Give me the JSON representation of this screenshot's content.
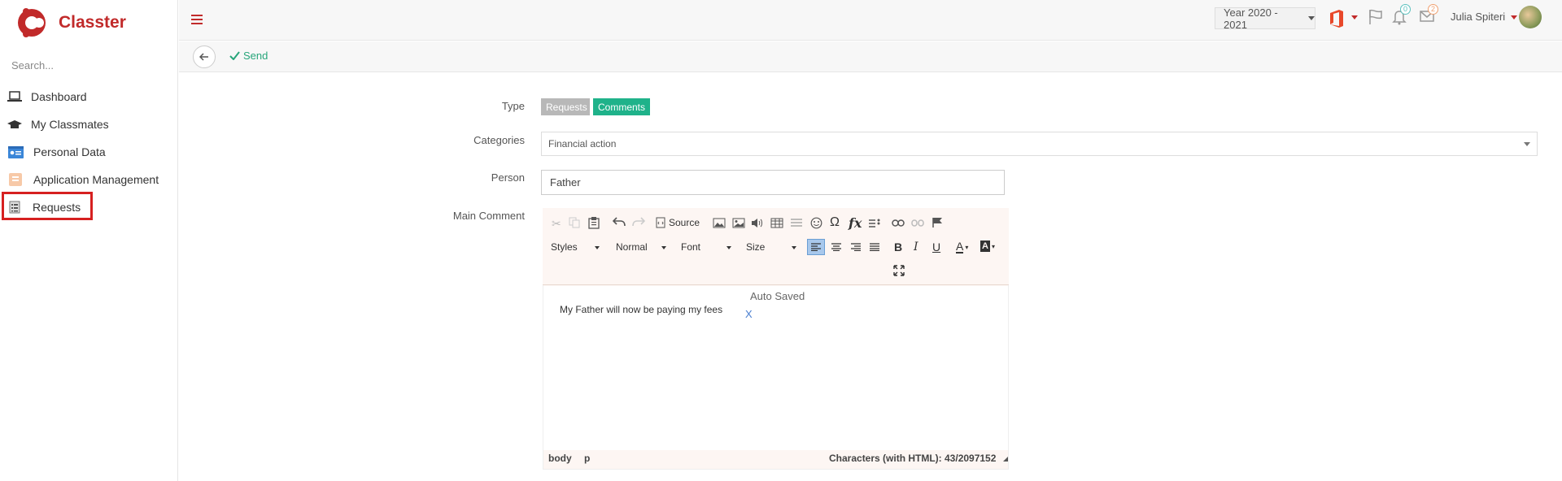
{
  "app": {
    "name": "Classter",
    "brand_color": "#c12a2a"
  },
  "sidebar": {
    "search_placeholder": "Search...",
    "items": [
      {
        "label": "Dashboard",
        "icon": "laptop-icon"
      },
      {
        "label": "My Classmates",
        "icon": "graduation-cap-icon"
      },
      {
        "label": "Personal Data",
        "icon": "id-card-icon"
      },
      {
        "label": "Application Management",
        "icon": "application-icon"
      },
      {
        "label": "Requests",
        "icon": "list-icon",
        "highlighted": true
      }
    ]
  },
  "topbar": {
    "year": "Year 2020 - 2021",
    "notifications_count": "0",
    "messages_count": "2",
    "user_name": "Julia Spiteri"
  },
  "actionbar": {
    "send_label": "Send"
  },
  "form": {
    "type_label": "Type",
    "type_options": [
      {
        "label": "Requests",
        "active": false
      },
      {
        "label": "Comments",
        "active": true
      }
    ],
    "categories_label": "Categories",
    "categories_value": "Financial action",
    "person_label": "Person",
    "person_value": "Father",
    "main_comment_label": "Main Comment"
  },
  "editor": {
    "source_label": "Source",
    "styles_label": "Styles",
    "format_label": "Normal",
    "font_label": "Font",
    "size_label": "Size",
    "autosaved_text": "Auto Saved",
    "content": "My Father will now be paying my fees",
    "dismiss_label": "X",
    "path": [
      "body",
      "p"
    ],
    "char_count": "Characters (with HTML): 43/2097152"
  },
  "colors": {
    "active_tag": "#1fb28a",
    "inactive_tag": "#b8b8b8",
    "send": "#27a57a"
  }
}
